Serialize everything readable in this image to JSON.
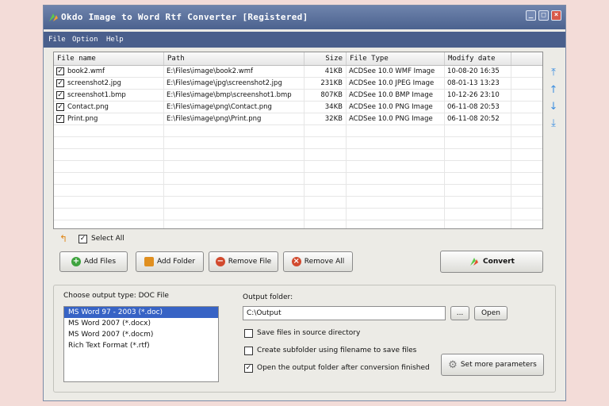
{
  "window": {
    "title": "Okdo Image to Word Rtf Converter [Registered]"
  },
  "menu": [
    "File",
    "Option",
    "Help"
  ],
  "file_list": {
    "columns": [
      "File name",
      "Path",
      "Size",
      "File Type",
      "Modify date"
    ],
    "rows": [
      {
        "checked": true,
        "name": "book2.wmf",
        "path": "E:\\Files\\image\\book2.wmf",
        "size": "41KB",
        "type": "ACDSee 10.0 WMF Image",
        "date": "10-08-20 16:35"
      },
      {
        "checked": true,
        "name": "screenshot2.jpg",
        "path": "E:\\Files\\image\\jpg\\screenshot2.jpg",
        "size": "231KB",
        "type": "ACDSee 10.0 JPEG Image",
        "date": "08-01-13 13:23"
      },
      {
        "checked": true,
        "name": "screenshot1.bmp",
        "path": "E:\\Files\\image\\bmp\\screenshot1.bmp",
        "size": "807KB",
        "type": "ACDSee 10.0 BMP Image",
        "date": "10-12-26 23:10"
      },
      {
        "checked": true,
        "name": "Contact.png",
        "path": "E:\\Files\\image\\png\\Contact.png",
        "size": "34KB",
        "type": "ACDSee 10.0 PNG Image",
        "date": "06-11-08 20:53"
      },
      {
        "checked": true,
        "name": "Print.png",
        "path": "E:\\Files\\image\\png\\Print.png",
        "size": "32KB",
        "type": "ACDSee 10.0 PNG Image",
        "date": "06-11-08 20:52"
      }
    ]
  },
  "select_all_label": "Select All",
  "buttons": {
    "add_files": "Add Files",
    "add_folder": "Add Folder",
    "remove_file": "Remove File",
    "remove_all": "Remove All",
    "convert": "Convert",
    "browse": "...",
    "open": "Open",
    "set_params": "Set more parameters"
  },
  "output": {
    "type_label": "Choose output type:  DOC File",
    "types": [
      "MS Word 97 - 2003 (*.doc)",
      "MS Word 2007 (*.docx)",
      "MS Word 2007 (*.docm)",
      "Rich Text Format (*.rtf)"
    ],
    "selected_index": 0,
    "folder_label": "Output folder:",
    "folder_value": "C:\\Output",
    "options": [
      {
        "label": "Save files in source directory",
        "checked": false
      },
      {
        "label": "Create subfolder using filename to save files",
        "checked": false
      },
      {
        "label": "Open the output folder after conversion finished",
        "checked": true
      }
    ]
  },
  "colors": {
    "title_bar": "#5a6f9c",
    "menu_bar": "#4a5f8c",
    "selection": "#3763c5",
    "arrow_icon": "#3c8ee0"
  }
}
